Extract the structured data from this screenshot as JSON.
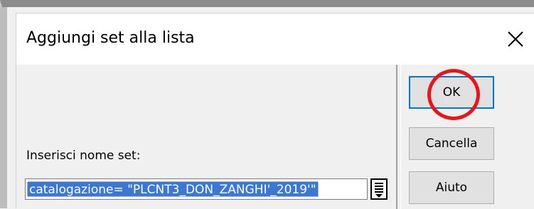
{
  "dialog": {
    "title": "Aggiungi set alla lista",
    "close_icon": "close-icon",
    "label": "Inserisci nome set:",
    "input_value": "catalogazione= \"PLCNT3_DON_ZANGHI'_2019'\"",
    "list_icon": "list-picker-icon"
  },
  "buttons": {
    "ok": "OK",
    "cancel": "Cancella",
    "help": "Aiuto"
  },
  "colors": {
    "selection": "#3a78d4",
    "default_button_border": "#0078d7",
    "annotation_ring": "#e8151b"
  }
}
